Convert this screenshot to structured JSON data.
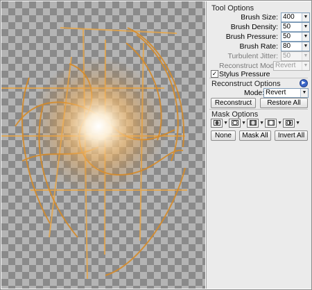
{
  "tool_options": {
    "title": "Tool Options",
    "brush_size": {
      "label": "Brush Size:",
      "value": "400"
    },
    "brush_density": {
      "label": "Brush Density:",
      "value": "50"
    },
    "brush_pressure": {
      "label": "Brush Pressure:",
      "value": "50"
    },
    "brush_rate": {
      "label": "Brush Rate:",
      "value": "80"
    },
    "turbulent_jitter": {
      "label": "Turbulent Jitter:",
      "value": "50"
    },
    "reconstruct_mode": {
      "label": "Reconstruct Mode:",
      "value": "Revert"
    },
    "stylus_pressure": {
      "label": "Stylus Pressure",
      "checked": true
    }
  },
  "reconstruct_options": {
    "title": "Reconstruct Options",
    "mode": {
      "label": "Mode:",
      "value": "Revert"
    },
    "reconstruct_button": "Reconstruct",
    "restore_all_button": "Restore All"
  },
  "mask_options": {
    "title": "Mask Options",
    "icons": [
      "mask-replace-icon",
      "mask-add-icon",
      "mask-subtract-icon",
      "mask-intersect-icon",
      "mask-invert-icon"
    ],
    "none_button": "None",
    "mask_all_button": "Mask All",
    "invert_all_button": "Invert All"
  },
  "colors": {
    "glow": "#f0a030",
    "line": "#e8a848",
    "panel_bg": "#ebebeb"
  }
}
